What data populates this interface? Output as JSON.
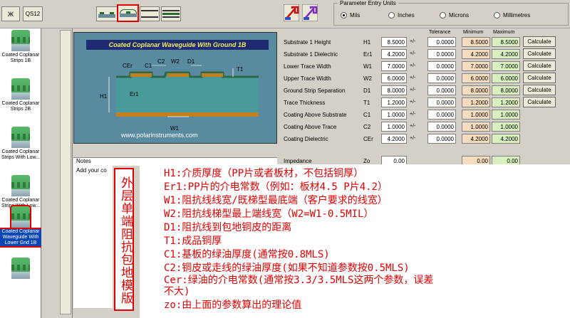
{
  "toolbar": {
    "btn1_label": "Ж",
    "btn2_label": "QS12",
    "units": {
      "legend": "Parameter Entry Units",
      "options": [
        "Mils",
        "Inches",
        "Microns",
        "Millimetres"
      ],
      "selected": "Mils"
    }
  },
  "sidebar": {
    "items": [
      {
        "label": "Coated Coplanar Strips 1B"
      },
      {
        "label": "Coated Coplanar Strips 2B"
      },
      {
        "label": "Coated Coplanar Strips With Low..."
      },
      {
        "label": "Coated Coplanar Strips With Low..."
      },
      {
        "label": "Coated Coplanar Waveguide With Lower Gnd 1B"
      }
    ]
  },
  "diagram": {
    "title": "Coated Coplanar Waveguide With Ground 1B",
    "url": "www.polarinstruments.com",
    "labels": {
      "cer": "CEr",
      "c1": "C1",
      "c2": "C2",
      "w2": "W2",
      "d1": "D1",
      "t1": "T1",
      "h1": "H1",
      "er1": "Er1",
      "w1": "W1"
    }
  },
  "params": {
    "headers": {
      "tolerance": "Tolerance",
      "minimum": "Minimum",
      "maximum": "Maximum"
    },
    "pm": "+/-",
    "calc_label": "Calculate",
    "rows": [
      {
        "label": "Substrate 1 Height",
        "sym": "H1",
        "value": "8.5000",
        "tol": "0.0000",
        "min": "8.5000",
        "max": "8.5000",
        "calc": true
      },
      {
        "label": "Substrate 1 Dielectric",
        "sym": "Er1",
        "value": "4.2000",
        "tol": "0.0000",
        "min": "4.2000",
        "max": "4.2000",
        "calc": true
      },
      {
        "label": "Lower Trace Width",
        "sym": "W1",
        "value": "7.0000",
        "tol": "0.0000",
        "min": "7.0000",
        "max": "7.0000",
        "calc": true
      },
      {
        "label": "Upper Trace Width",
        "sym": "W2",
        "value": "6.0000",
        "tol": "0.0000",
        "min": "6.0000",
        "max": "6.0000",
        "calc": true
      },
      {
        "label": "Ground Strip Separation",
        "sym": "D1",
        "value": "8.0000",
        "tol": "0.0000",
        "min": "8.0000",
        "max": "8.0000",
        "calc": true
      },
      {
        "label": "Trace Thickness",
        "sym": "T1",
        "value": "1.2000",
        "tol": "0.0000",
        "min": "1.2000",
        "max": "1.2000",
        "calc": true
      },
      {
        "label": "Coating Above Substrate",
        "sym": "C1",
        "value": "1.0000",
        "tol": "0.0000",
        "min": "1.0000",
        "max": "1.0000",
        "calc": false
      },
      {
        "label": "Coating Above Trace",
        "sym": "C2",
        "value": "1.0000",
        "tol": "0.0000",
        "min": "1.0000",
        "max": "1.0000",
        "calc": false
      },
      {
        "label": "Coating Dielectric",
        "sym": "CEr",
        "value": "4.2000",
        "tol": "0.0000",
        "min": "4.2000",
        "max": "4.2000",
        "calc": false
      }
    ],
    "impedance": {
      "label": "Impedance",
      "sym": "Zo",
      "value": "0.00",
      "min": "0.00",
      "max": "0.00"
    }
  },
  "notes": {
    "header": "Notes",
    "text": "Add your co"
  },
  "annotation": {
    "vertical_label": "外层单端阻抗包地模版",
    "lines": [
      "H1:介质厚度（PP片或者板材，不包括铜厚）",
      "Er1:PP片的介电常数（例如：板材4.5  P片4.2）",
      "W1:阻抗线线宽/既梯型最底端（客户要求的线宽）",
      "W2:阻抗线梯型最上端线宽（W2=W1-0.5MIL）",
      "D1:阻抗线到包地铜皮的距离",
      "T1:成品铜厚",
      "C1:基板的绿油厚度(通常按0.8MLS)",
      "C2:铜皮或走线的绿油厚度(如果不知道参数按0.5MLS)",
      "Cer:绿油的介电常数(通常按3.3/3.5MLS这两个参数，误差",
      "不大)",
      "zo:由上面的参数算出的理论值"
    ]
  },
  "colors": {
    "min_fill": "#f8dcc0",
    "max_fill": "#d8f0c0",
    "accent": "#e00000",
    "selected": "#0a46b8"
  }
}
